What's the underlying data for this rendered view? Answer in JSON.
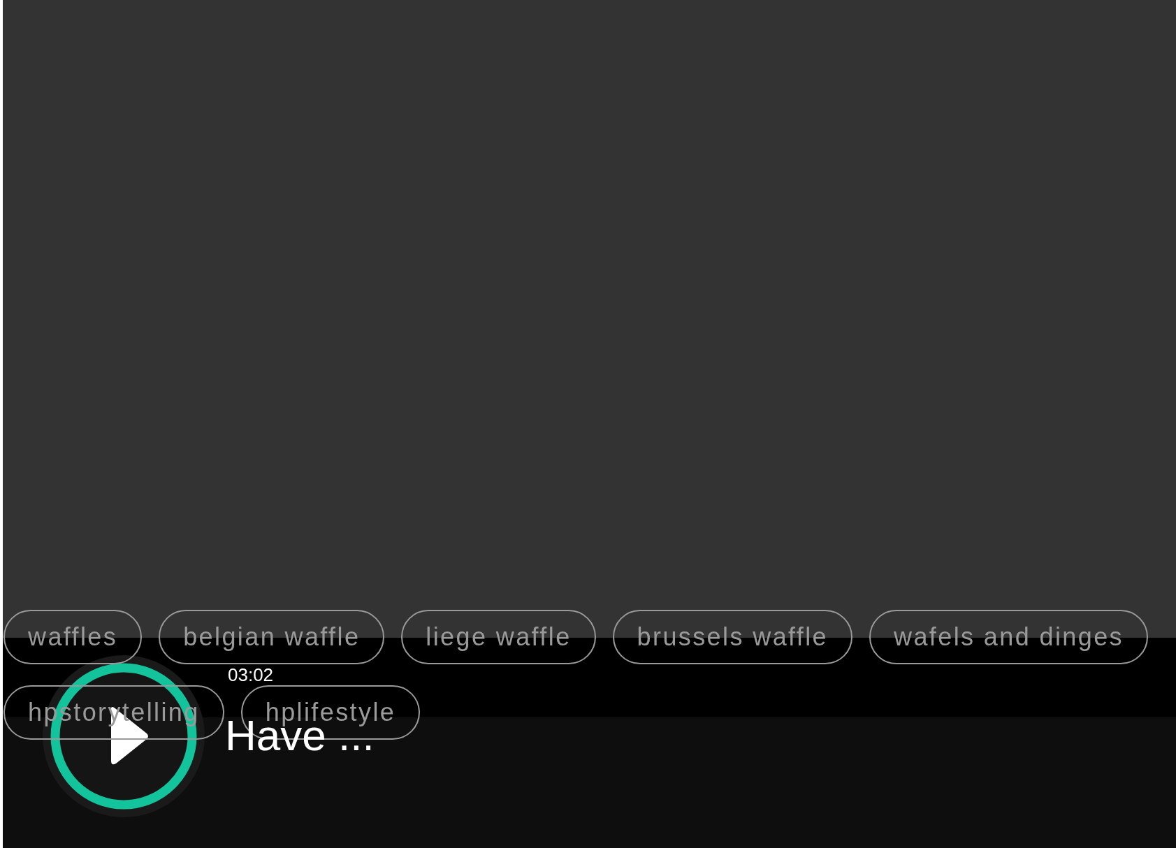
{
  "tags": [
    {
      "label": "waffles"
    },
    {
      "label": "belgian waffle"
    },
    {
      "label": "liege waffle"
    },
    {
      "label": "brussels waffle"
    },
    {
      "label": "wafels and dinges"
    },
    {
      "label": "hpstorytelling"
    },
    {
      "label": "hplifestyle"
    }
  ],
  "player": {
    "duration": "03:02",
    "title": "Have ..."
  }
}
